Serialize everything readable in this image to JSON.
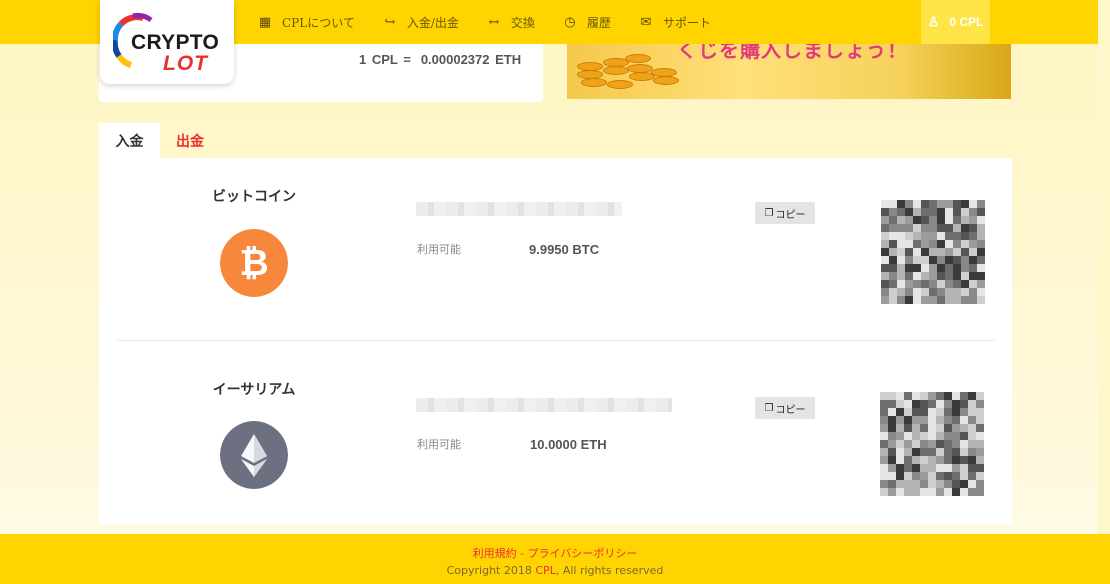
{
  "header": {
    "logo": {
      "line1": "CRYPTO",
      "line2": "LOT"
    },
    "nav": [
      {
        "label": "CPLについて",
        "icon": "calculator-icon"
      },
      {
        "label": "入金/出金",
        "icon": "share-arrow-icon"
      },
      {
        "label": "交換",
        "icon": "exchange-arrows-icon"
      },
      {
        "label": "履歴",
        "icon": "history-icon"
      },
      {
        "label": "サポート",
        "icon": "mail-icon"
      }
    ],
    "user": {
      "balance": "0 CPL",
      "icon": "user-icon"
    }
  },
  "rate": {
    "label": "1 CPL =",
    "value": "0.00002372 ETH"
  },
  "banner": {
    "text": "くじを購入しましょう！"
  },
  "tabs": {
    "deposit": "入金",
    "withdraw": "出金"
  },
  "wallets": [
    {
      "name": "ビットコイン",
      "icon": "bitcoin-icon",
      "available_label": "利用可能",
      "available_value": "9.9950 BTC",
      "copy_label": "コピー",
      "color": "#f7931a"
    },
    {
      "name": "イーサリアム",
      "icon": "ethereum-icon",
      "available_label": "利用可能",
      "available_value": "10.0000 ETH",
      "copy_label": "コピー",
      "color": "#6d7080"
    }
  ],
  "footer": {
    "terms": "利用規約",
    "separator": " - ",
    "privacy": "プライバシーポリシー",
    "copyright_prefix": "Copyright 2018 ",
    "copyright_brand": "CPL",
    "copyright_suffix": ", All rights reserved"
  },
  "colors": {
    "accent": "#ffd400",
    "brand_red": "#e8322e"
  }
}
